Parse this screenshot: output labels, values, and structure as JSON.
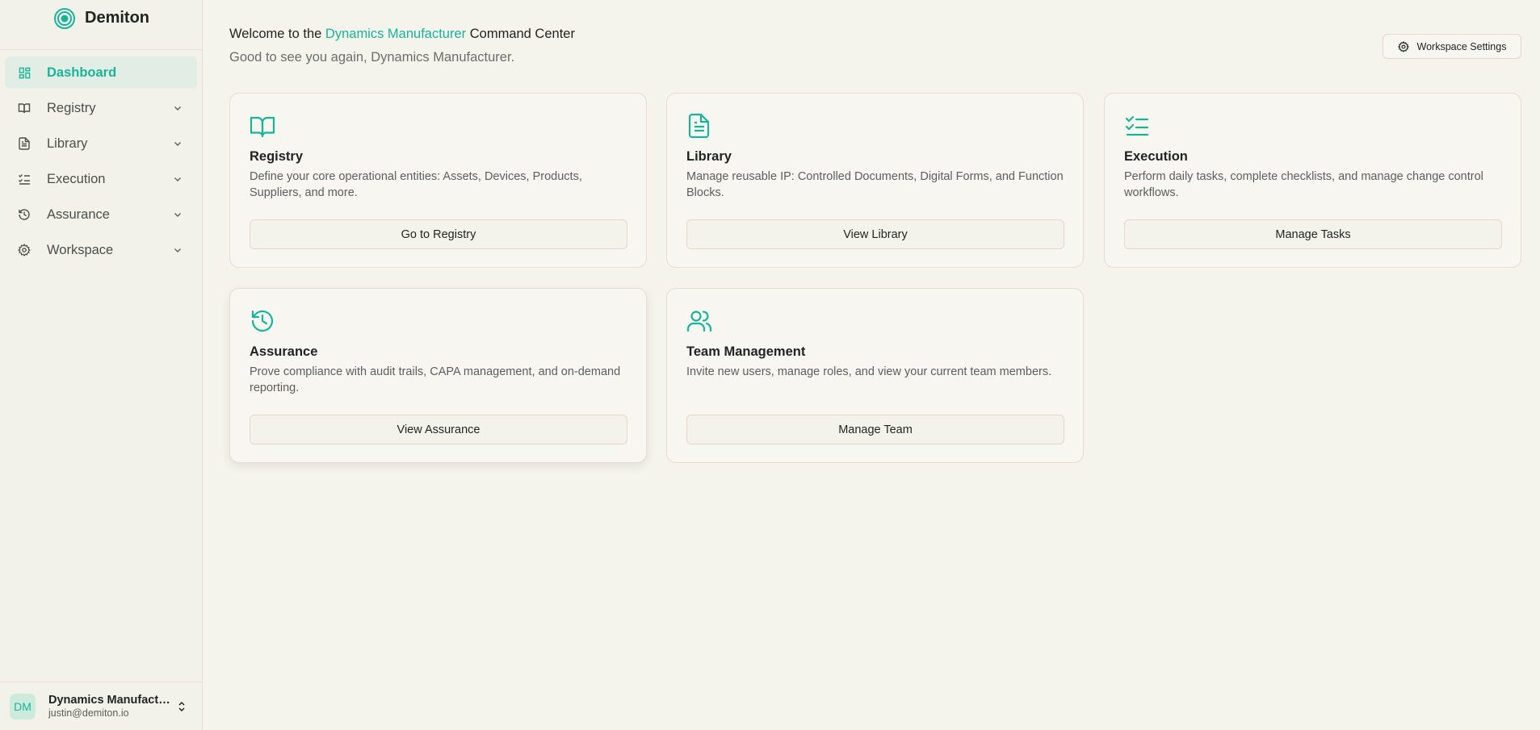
{
  "brand": {
    "name": "Demiton",
    "accent_color": "#18b49a"
  },
  "sidebar": {
    "items": [
      {
        "label": "Dashboard",
        "icon": "dashboard-icon",
        "active": true
      },
      {
        "label": "Registry",
        "icon": "book-open-icon"
      },
      {
        "label": "Library",
        "icon": "document-icon"
      },
      {
        "label": "Execution",
        "icon": "checklist-icon"
      },
      {
        "label": "Assurance",
        "icon": "history-icon"
      },
      {
        "label": "Workspace",
        "icon": "gear-icon"
      }
    ]
  },
  "user": {
    "initials": "DM",
    "name": "Dynamics Manufacturer",
    "email": "justin@demiton.io"
  },
  "header": {
    "welcome_prefix": "Welcome to the ",
    "welcome_accent": "Dynamics Manufacturer",
    "welcome_suffix": " Command Center",
    "subtitle": "Good to see you again, Dynamics Manufacturer.",
    "settings_button": "Workspace Settings"
  },
  "cards": [
    {
      "title": "Registry",
      "icon": "book-open-icon",
      "description": "Define your core operational entities: Assets, Devices, Products, Suppliers, and more.",
      "button": "Go to Registry"
    },
    {
      "title": "Library",
      "icon": "document-icon",
      "description": "Manage reusable IP: Controlled Documents, Digital Forms, and Function Blocks.",
      "button": "View Library"
    },
    {
      "title": "Execution",
      "icon": "checklist-icon",
      "description": "Perform daily tasks, complete checklists, and manage change control workflows.",
      "button": "Manage Tasks"
    },
    {
      "title": "Assurance",
      "icon": "history-icon",
      "description": "Prove compliance with audit trails, CAPA management, and on-demand reporting.",
      "button": "View Assurance"
    },
    {
      "title": "Team Management",
      "icon": "users-icon",
      "description": "Invite new users, manage roles, and view your current team members.",
      "button": "Manage Team"
    }
  ]
}
